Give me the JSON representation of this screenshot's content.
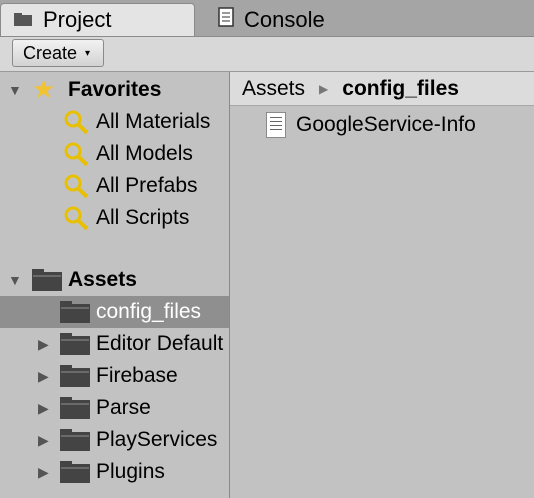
{
  "tabs": [
    {
      "label": "Project",
      "icon": "folder-tab-icon",
      "active": true
    },
    {
      "label": "Console",
      "icon": "console-icon",
      "active": false
    }
  ],
  "toolbar": {
    "create_label": "Create",
    "create_arrow": "▾"
  },
  "sidebar": {
    "favorites": {
      "label": "Favorites",
      "expanded": true,
      "items": [
        "All Materials",
        "All Models",
        "All Prefabs",
        "All Scripts"
      ]
    },
    "assets": {
      "label": "Assets",
      "expanded": true,
      "items": [
        {
          "label": "config_files",
          "selected": true,
          "has_children": false
        },
        {
          "label": "Editor Default Resources",
          "selected": false,
          "has_children": true
        },
        {
          "label": "Firebase",
          "selected": false,
          "has_children": true
        },
        {
          "label": "Parse",
          "selected": false,
          "has_children": true
        },
        {
          "label": "PlayServices",
          "selected": false,
          "has_children": true
        },
        {
          "label": "Plugins",
          "selected": false,
          "has_children": true
        }
      ]
    }
  },
  "main": {
    "breadcrumb": [
      "Assets",
      "config_files"
    ],
    "files": [
      {
        "name": "GoogleService-Info",
        "icon": "text-file-icon"
      }
    ]
  }
}
